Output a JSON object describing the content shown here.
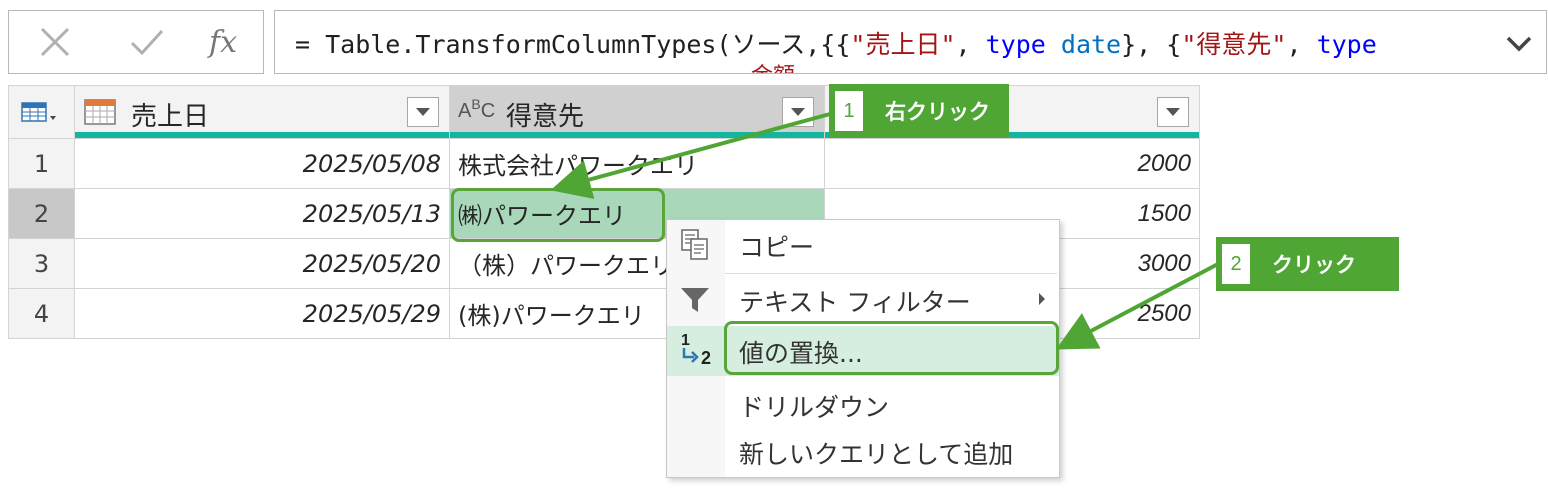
{
  "formula_bar": {
    "formula_prefix": "= Table.TransformColumnTypes(ソース,{{",
    "str1": "\"売上日\"",
    "sep1": ", ",
    "kw_type1": "type",
    "kw_date": "date",
    "mid": "}, {",
    "str2": "\"得意先\"",
    "sep2": ", ",
    "kw_type2": "type",
    "overflow_text": "金額"
  },
  "table": {
    "columns": [
      {
        "label": "売上日",
        "type_icon": "calendar-icon"
      },
      {
        "label": "得意先",
        "type_icon": "abc-text-icon",
        "type_text_a": "A",
        "type_text_b": "B",
        "type_text_c": "C"
      },
      {
        "label": "",
        "type_icon": ""
      }
    ],
    "rows": [
      {
        "num": "1",
        "date": "2025/05/08",
        "customer": "株式会社パワークエリ",
        "amount": "2000"
      },
      {
        "num": "2",
        "date": "2025/05/13",
        "customer": "㈱パワークエリ",
        "amount": "1500"
      },
      {
        "num": "3",
        "date": "2025/05/20",
        "customer": "（株）パワークエリ",
        "amount": "3000"
      },
      {
        "num": "4",
        "date": "2025/05/29",
        "customer": "(株)パワークエリ",
        "amount": "2500"
      }
    ]
  },
  "context_menu": {
    "items": [
      {
        "label": "コピー",
        "icon": "copy-icon"
      },
      {
        "label": "テキスト フィルター",
        "icon": "filter-icon",
        "submenu": true
      },
      {
        "label": "値の置換...",
        "icon": "replace-values-icon",
        "icon_text_1": "1",
        "icon_text_2": "2"
      },
      {
        "label": "ドリルダウン",
        "icon": ""
      },
      {
        "label": "新しいクエリとして追加",
        "icon": ""
      }
    ]
  },
  "callouts": [
    {
      "num": "1",
      "text": "右クリック"
    },
    {
      "num": "2",
      "text": "クリック"
    }
  ],
  "colors": {
    "accent_green": "#4fa635",
    "header_teal": "#12b5a0",
    "selected_cell": "#a8d8b9",
    "menu_active": "#d6eedf"
  }
}
